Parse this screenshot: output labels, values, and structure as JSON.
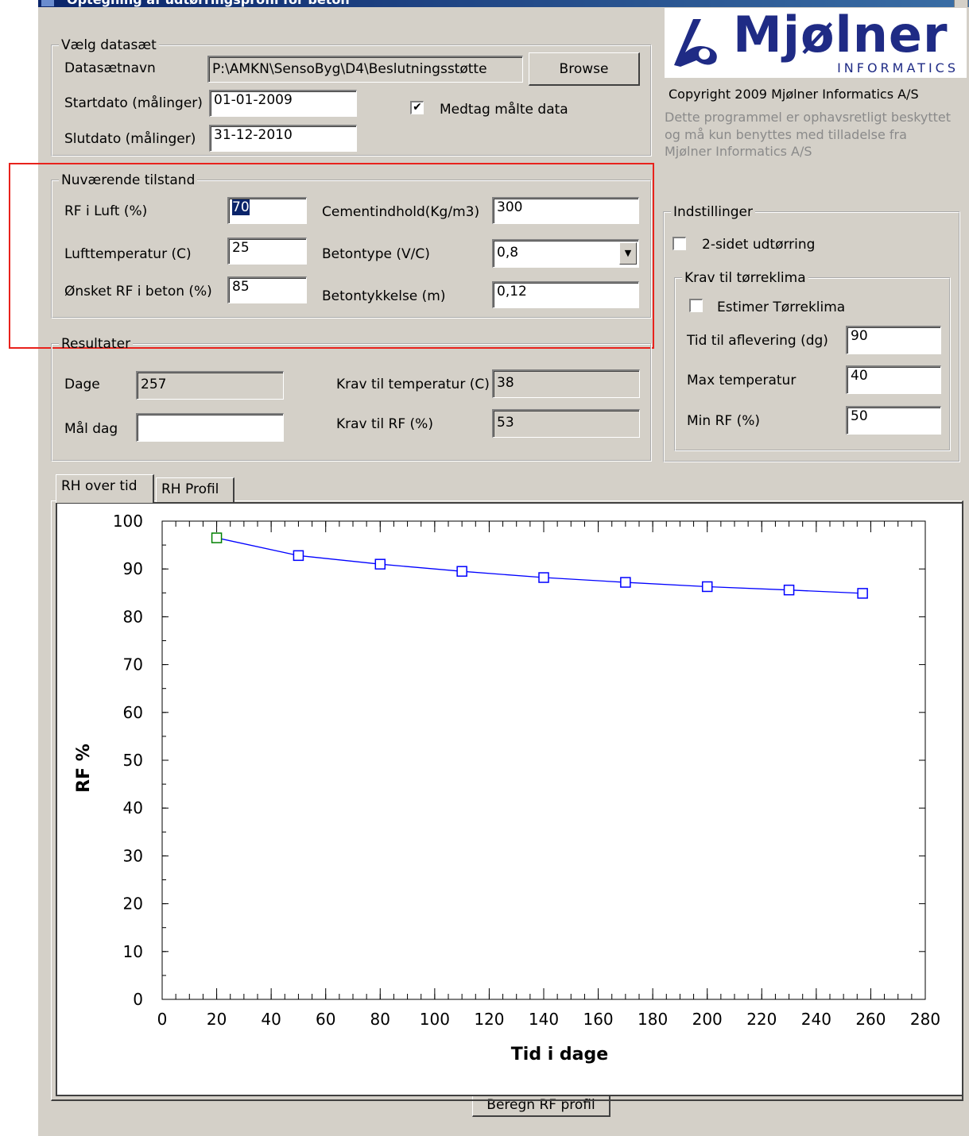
{
  "window": {
    "title": "Optegning af udtørringsprofil for beton"
  },
  "dataset": {
    "group_label": "Vælg datasæt",
    "name_label": "Datasætnavn",
    "name_value": "P:\\AMKN\\SensoByg\\D4\\Beslutningsstøtte",
    "browse_label": "Browse",
    "start_label": "Startdato (målinger)",
    "start_value": "01-01-2009",
    "end_label": "Slutdato (målinger)",
    "end_value": "31-12-2010",
    "include_label": "Medtag målte data",
    "include_checked": true
  },
  "brand": {
    "logo_text": "Mjølner",
    "logo_sub": "INFORMATICS",
    "copyright": "Copyright 2009 Mjølner Informatics A/S",
    "notice_line1": "Dette programmel er ophavsretligt beskyttet",
    "notice_line2": "og må kun benyttes med tilladelse fra",
    "notice_line3": "Mjølner Informatics A/S"
  },
  "current": {
    "group_label": "Nuværende tilstand",
    "rf_air_label": "RF i Luft (%)",
    "rf_air_value": "70",
    "air_temp_label": "Lufttemperatur (C)",
    "air_temp_value": "25",
    "desired_rf_label": "Ønsket RF i beton (%)",
    "desired_rf_value": "85",
    "cement_label": "Cementindhold(Kg/m3)",
    "cement_value": "300",
    "concrete_type_label": "Betontype (V/C)",
    "concrete_type_value": "0,8",
    "thickness_label": "Betontykkelse (m)",
    "thickness_value": "0,12"
  },
  "results": {
    "group_label": "Resultater",
    "days_label": "Dage",
    "days_value": "257",
    "goal_day_label": "Mål dag",
    "goal_day_value": "",
    "req_temp_label": "Krav til temperatur (C)",
    "req_temp_value": "38",
    "req_rf_label": "Krav til RF (%)",
    "req_rf_value": "53"
  },
  "settings": {
    "group_label": "Indstillinger",
    "two_sided_label": "2-sidet udtørring",
    "two_sided_checked": false,
    "climate_group_label": "Krav til tørreklima",
    "estimate_label": "Estimer Tørreklima",
    "estimate_checked": false,
    "delivery_label": "Tid til aflevering (dg)",
    "delivery_value": "90",
    "max_temp_label": "Max temperatur",
    "max_temp_value": "40",
    "min_rf_label": "Min RF (%)",
    "min_rf_value": "50"
  },
  "tabs": {
    "rh_over_time": "RH over tid",
    "rh_profile": "RH Profil",
    "active": "rh_over_time"
  },
  "bottom": {
    "compute_button_label": "Beregn RF profil"
  },
  "chart_data": {
    "type": "line",
    "xlabel": "Tid i dage",
    "ylabel": "RF %",
    "xlim": [
      0,
      280
    ],
    "ylim": [
      0,
      100
    ],
    "x_ticks": [
      "0",
      "20",
      "40",
      "60",
      "80",
      "100",
      "120",
      "140",
      "160",
      "180",
      "200",
      "220",
      "240",
      "260",
      "280"
    ],
    "y_ticks": [
      "0",
      "10",
      "20",
      "30",
      "40",
      "50",
      "60",
      "70",
      "80",
      "90",
      "100"
    ],
    "series": [
      {
        "x": [
          20,
          50,
          80,
          110,
          140,
          170,
          200,
          230,
          257
        ],
        "y": [
          96.5,
          92.8,
          91.0,
          89.5,
          88.2,
          87.2,
          86.3,
          85.6,
          84.9
        ],
        "color": "#0000ff",
        "first_marker_color": "#008000"
      }
    ],
    "grid": false
  }
}
